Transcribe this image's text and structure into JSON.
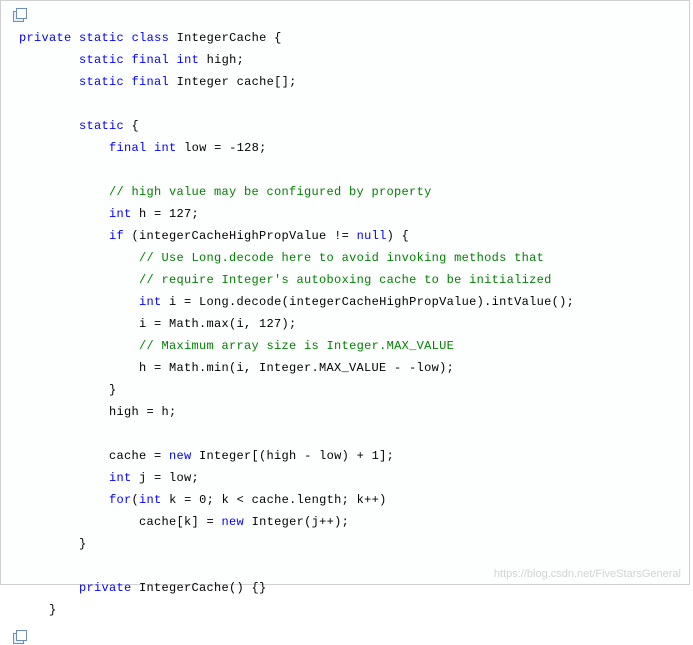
{
  "icons": {
    "copy": "copy-icon"
  },
  "watermark": "https://blog.csdn.net/FiveStarsGeneral",
  "code": {
    "tokens": [
      {
        "t": "kw",
        "v": "private"
      },
      {
        "t": "pl",
        "v": " "
      },
      {
        "t": "kw",
        "v": "static"
      },
      {
        "t": "pl",
        "v": " "
      },
      {
        "t": "kw",
        "v": "class"
      },
      {
        "t": "pl",
        "v": " IntegerCache {\n"
      },
      {
        "t": "pl",
        "v": "        "
      },
      {
        "t": "kw",
        "v": "static"
      },
      {
        "t": "pl",
        "v": " "
      },
      {
        "t": "kw",
        "v": "final"
      },
      {
        "t": "pl",
        "v": " "
      },
      {
        "t": "kw",
        "v": "int"
      },
      {
        "t": "pl",
        "v": " high;\n"
      },
      {
        "t": "pl",
        "v": "        "
      },
      {
        "t": "kw",
        "v": "static"
      },
      {
        "t": "pl",
        "v": " "
      },
      {
        "t": "kw",
        "v": "final"
      },
      {
        "t": "pl",
        "v": " Integer cache[];\n"
      },
      {
        "t": "pl",
        "v": "\n"
      },
      {
        "t": "pl",
        "v": "        "
      },
      {
        "t": "kw",
        "v": "static"
      },
      {
        "t": "pl",
        "v": " {\n"
      },
      {
        "t": "pl",
        "v": "            "
      },
      {
        "t": "kw",
        "v": "final"
      },
      {
        "t": "pl",
        "v": " "
      },
      {
        "t": "kw",
        "v": "int"
      },
      {
        "t": "pl",
        "v": " low = -128;\n"
      },
      {
        "t": "pl",
        "v": "\n"
      },
      {
        "t": "pl",
        "v": "            "
      },
      {
        "t": "cm",
        "v": "// high value may be configured by property"
      },
      {
        "t": "pl",
        "v": "\n"
      },
      {
        "t": "pl",
        "v": "            "
      },
      {
        "t": "kw",
        "v": "int"
      },
      {
        "t": "pl",
        "v": " h = 127;\n"
      },
      {
        "t": "pl",
        "v": "            "
      },
      {
        "t": "kw",
        "v": "if"
      },
      {
        "t": "pl",
        "v": " (integerCacheHighPropValue != "
      },
      {
        "t": "kw",
        "v": "null"
      },
      {
        "t": "pl",
        "v": ") {\n"
      },
      {
        "t": "pl",
        "v": "                "
      },
      {
        "t": "cm",
        "v": "// Use Long.decode here to avoid invoking methods that"
      },
      {
        "t": "pl",
        "v": "\n"
      },
      {
        "t": "pl",
        "v": "                "
      },
      {
        "t": "cm",
        "v": "// require Integer's autoboxing cache to be initialized"
      },
      {
        "t": "pl",
        "v": "\n"
      },
      {
        "t": "pl",
        "v": "                "
      },
      {
        "t": "kw",
        "v": "int"
      },
      {
        "t": "pl",
        "v": " i = Long.decode(integerCacheHighPropValue).intValue();\n"
      },
      {
        "t": "pl",
        "v": "                i = Math.max(i, 127);\n"
      },
      {
        "t": "pl",
        "v": "                "
      },
      {
        "t": "cm",
        "v": "// Maximum array size is Integer.MAX_VALUE"
      },
      {
        "t": "pl",
        "v": "\n"
      },
      {
        "t": "pl",
        "v": "                h = Math.min(i, Integer.MAX_VALUE - -low);\n"
      },
      {
        "t": "pl",
        "v": "            }\n"
      },
      {
        "t": "pl",
        "v": "            high = h;\n"
      },
      {
        "t": "pl",
        "v": "\n"
      },
      {
        "t": "pl",
        "v": "            cache = "
      },
      {
        "t": "kw",
        "v": "new"
      },
      {
        "t": "pl",
        "v": " Integer[(high - low) + 1];\n"
      },
      {
        "t": "pl",
        "v": "            "
      },
      {
        "t": "kw",
        "v": "int"
      },
      {
        "t": "pl",
        "v": " j = low;\n"
      },
      {
        "t": "pl",
        "v": "            "
      },
      {
        "t": "kw",
        "v": "for"
      },
      {
        "t": "pl",
        "v": "("
      },
      {
        "t": "kw",
        "v": "int"
      },
      {
        "t": "pl",
        "v": " k = 0; k < cache.length; k++)\n"
      },
      {
        "t": "pl",
        "v": "                cache[k] = "
      },
      {
        "t": "kw",
        "v": "new"
      },
      {
        "t": "pl",
        "v": " Integer(j++);\n"
      },
      {
        "t": "pl",
        "v": "        }\n"
      },
      {
        "t": "pl",
        "v": "\n"
      },
      {
        "t": "pl",
        "v": "        "
      },
      {
        "t": "kw",
        "v": "private"
      },
      {
        "t": "pl",
        "v": " IntegerCache() {}\n"
      },
      {
        "t": "pl",
        "v": "    }"
      }
    ]
  }
}
